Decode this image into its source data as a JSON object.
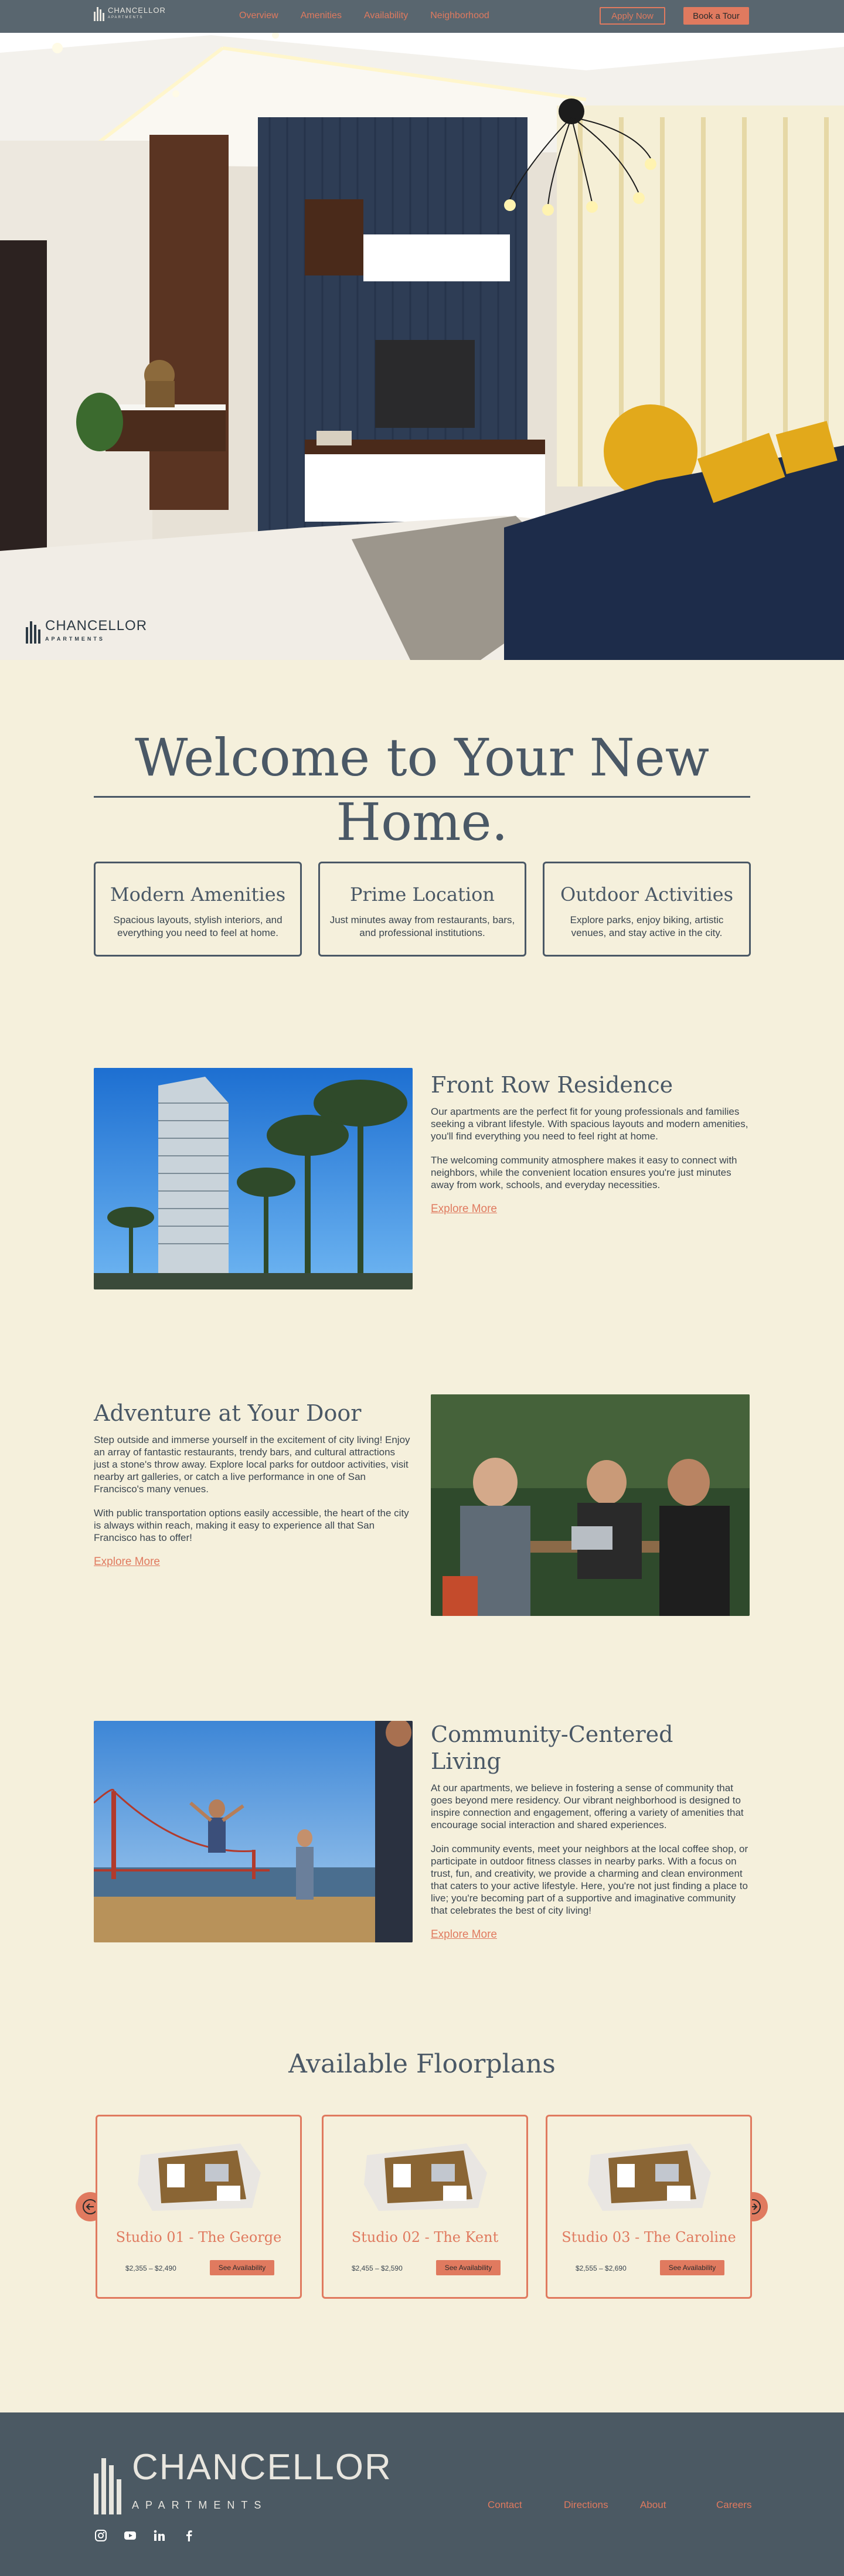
{
  "brand": {
    "name": "CHANCELLOR",
    "sub": "APARTMENTS"
  },
  "nav": {
    "links": [
      "Overview",
      "Amenities",
      "Availability",
      "Neighborhood"
    ],
    "apply_label": "Apply Now",
    "tour_label": "Book a Tour"
  },
  "welcome": {
    "title": "Welcome to Your New Home."
  },
  "features": [
    {
      "title": "Modern Amenities",
      "text": "Spacious layouts, stylish interiors, and everything you need to feel at home."
    },
    {
      "title": "Prime Location",
      "text": "Just minutes away from restaurants, bars, and professional institutions."
    },
    {
      "title": "Outdoor Activities",
      "text": "Explore parks, enjoy biking, artistic venues, and stay active in the city."
    }
  ],
  "sections": [
    {
      "title": "Front Row Residence",
      "p1": "Our apartments are the perfect fit for young professionals and families seeking a vibrant lifestyle. With spacious layouts and modern amenities, you'll find everything you need to feel right at home.",
      "p2": "The welcoming community atmosphere makes it easy to connect with neighbors, while the convenient location ensures you're just minutes away from work, schools, and everyday necessities.",
      "link": "Explore More"
    },
    {
      "title": "Adventure at Your Door",
      "p1": "Step outside and immerse yourself in the excitement of city living! Enjoy an array of fantastic restaurants, trendy bars, and cultural attractions just a stone's throw away. Explore local parks for outdoor activities, visit nearby art galleries, or catch a live performance in one of San Francisco's many venues.",
      "p2": "With public transportation options easily accessible, the heart of the city is always within reach, making it easy to experience all that San Francisco has to offer!",
      "link": "Explore More"
    },
    {
      "title": "Community-Centered Living",
      "p1": "At our apartments, we believe in fostering a sense of community that goes beyond mere residency. Our vibrant neighborhood is designed to inspire connection and engagement, offering a variety of amenities that encourage social interaction and shared experiences.",
      "p2": "Join community events, meet your neighbors at the local coffee shop, or participate in outdoor fitness classes in nearby parks. With a focus on trust, fun, and creativity, we provide a charming and clean environment that caters to your active lifestyle. Here, you're not just finding a place to live; you're becoming part of a supportive and imaginative community that celebrates the best of city living!",
      "link": "Explore More"
    }
  ],
  "floorplans": {
    "title": "Available Floorplans",
    "items": [
      {
        "name": "Studio 01 - The George",
        "price": "$2,355 – $2,490",
        "button": "See Availability"
      },
      {
        "name": "Studio 02 - The Kent",
        "price": "$2,455 – $2,590",
        "button": "See Availability"
      },
      {
        "name": "Studio 03 - The Caroline",
        "price": "$2,555 – $2,690",
        "button": "See Availability"
      }
    ]
  },
  "footer": {
    "links": [
      "Contact",
      "Directions",
      "About",
      "Careers"
    ],
    "socials": [
      "instagram-icon",
      "youtube-icon",
      "linkedin-icon",
      "facebook-icon"
    ]
  },
  "colors": {
    "accent": "#e07a5f",
    "slate": "#4b5963",
    "cream": "#f5f0dc"
  }
}
